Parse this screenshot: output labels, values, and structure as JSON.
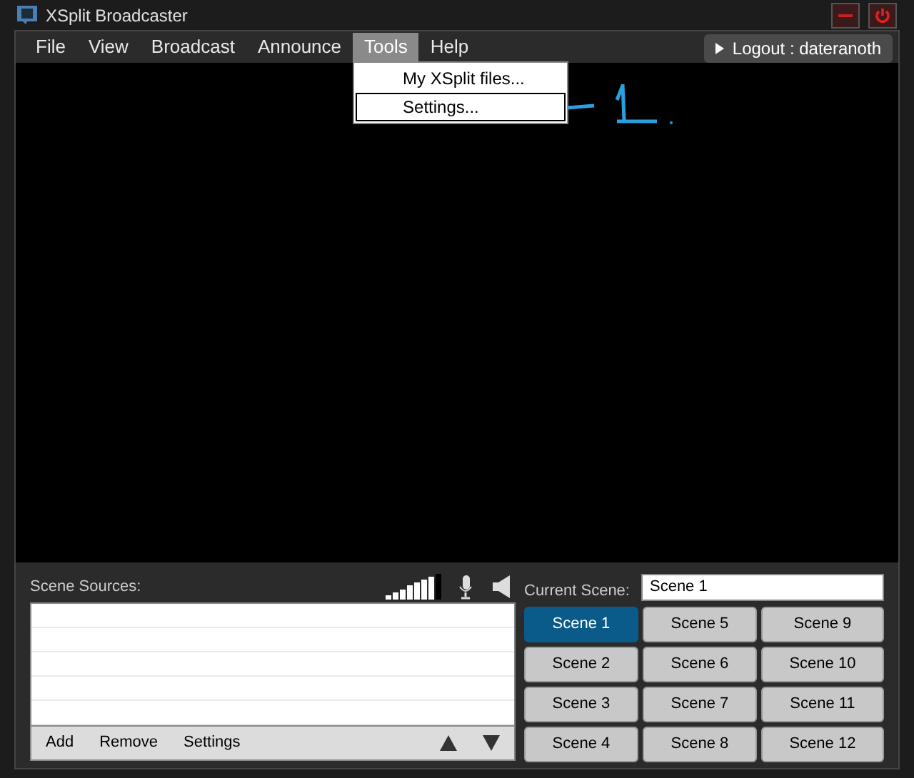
{
  "window": {
    "title": "XSplit Broadcaster"
  },
  "menu": [
    {
      "label": "File",
      "selected": false
    },
    {
      "label": "View",
      "selected": false
    },
    {
      "label": "Broadcast",
      "selected": false
    },
    {
      "label": "Announce",
      "selected": false
    },
    {
      "label": "Tools",
      "selected": true
    },
    {
      "label": "Help",
      "selected": false
    }
  ],
  "dropdown": [
    {
      "label": "My XSplit files...",
      "selected": false
    },
    {
      "label": "Settings...",
      "selected": true
    }
  ],
  "logout": {
    "label": "Logout : dateranoth"
  },
  "scene_sources": {
    "label": "Scene Sources:",
    "volume": {
      "level": 0.875
    },
    "actions": [
      "Add",
      "Remove",
      "Settings"
    ]
  },
  "current_scene": {
    "label": "Current Scene:",
    "value": "Scene 1"
  },
  "scenes": [
    {
      "label": "Scene 1",
      "selected": true
    },
    {
      "label": "Scene 2",
      "selected": false
    },
    {
      "label": "Scene 3",
      "selected": false
    },
    {
      "label": "Scene 4",
      "selected": false
    },
    {
      "label": "Scene 5",
      "selected": false
    },
    {
      "label": "Scene 6",
      "selected": false
    },
    {
      "label": "Scene 7",
      "selected": false
    },
    {
      "label": "Scene 8",
      "selected": false
    },
    {
      "label": "Scene 9",
      "selected": false
    },
    {
      "label": "Scene 10",
      "selected": false
    },
    {
      "label": "Scene 11",
      "selected": false
    },
    {
      "label": "Scene 12",
      "selected": false
    }
  ]
}
